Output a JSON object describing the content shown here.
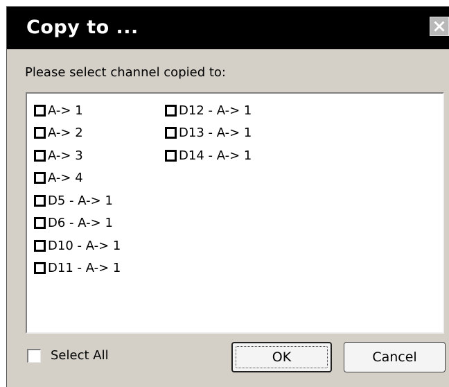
{
  "dialog": {
    "title": "Copy to ...",
    "close_icon": "close-icon",
    "prompt": "Please select channel copied to:",
    "channels_col1": [
      {
        "label": "A-> 1",
        "checked": false
      },
      {
        "label": "A-> 2",
        "checked": false
      },
      {
        "label": "A-> 3",
        "checked": false
      },
      {
        "label": "A-> 4",
        "checked": false
      },
      {
        "label": "D5 - A-> 1",
        "checked": false
      },
      {
        "label": "D6 - A-> 1",
        "checked": false
      },
      {
        "label": "D10 - A-> 1",
        "checked": false
      },
      {
        "label": "D11 - A-> 1",
        "checked": false
      }
    ],
    "channels_col2": [
      {
        "label": "D12 - A-> 1",
        "checked": false
      },
      {
        "label": "D13 - A-> 1",
        "checked": false
      },
      {
        "label": "D14 - A-> 1",
        "checked": false
      }
    ],
    "select_all_label": "Select All",
    "select_all_checked": false,
    "ok_label": "OK",
    "cancel_label": "Cancel"
  },
  "colors": {
    "titlebar": "#000000",
    "title_text": "#ffffff",
    "dialog_bg": "#d4d0c8",
    "list_bg": "#ffffff"
  }
}
